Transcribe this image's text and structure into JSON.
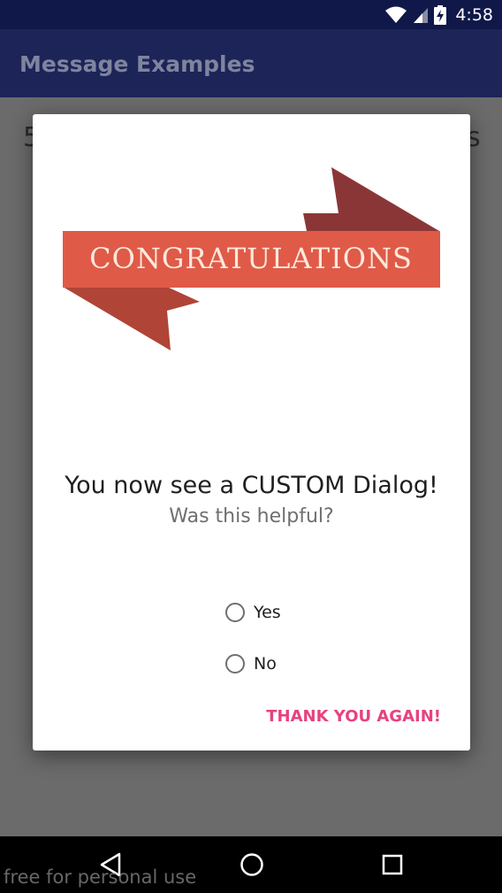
{
  "status_bar": {
    "time": "4:58",
    "icons": [
      "wifi-icon",
      "cell-signal-icon",
      "battery-charging-icon"
    ]
  },
  "app_bar": {
    "title": "Message Examples"
  },
  "background": {
    "left_text": "5",
    "right_text": "s"
  },
  "dialog": {
    "banner_text": "CONGRATULATIONS",
    "title": "You now see a CUSTOM Dialog!",
    "subtitle": "Was this helpful?",
    "options": [
      {
        "label": "Yes",
        "selected": false
      },
      {
        "label": "No",
        "selected": false
      }
    ],
    "action_label": "THANK YOU AGAIN!"
  },
  "nav_bar": {
    "buttons": [
      "back-icon",
      "home-icon",
      "recents-icon"
    ]
  },
  "watermark": "free for personal use",
  "colors": {
    "status_bar": "#0f1848",
    "app_bar": "#1c2458",
    "banner_main": "#e05a48",
    "banner_dark": "#8b3636",
    "accent": "#e8417f"
  }
}
